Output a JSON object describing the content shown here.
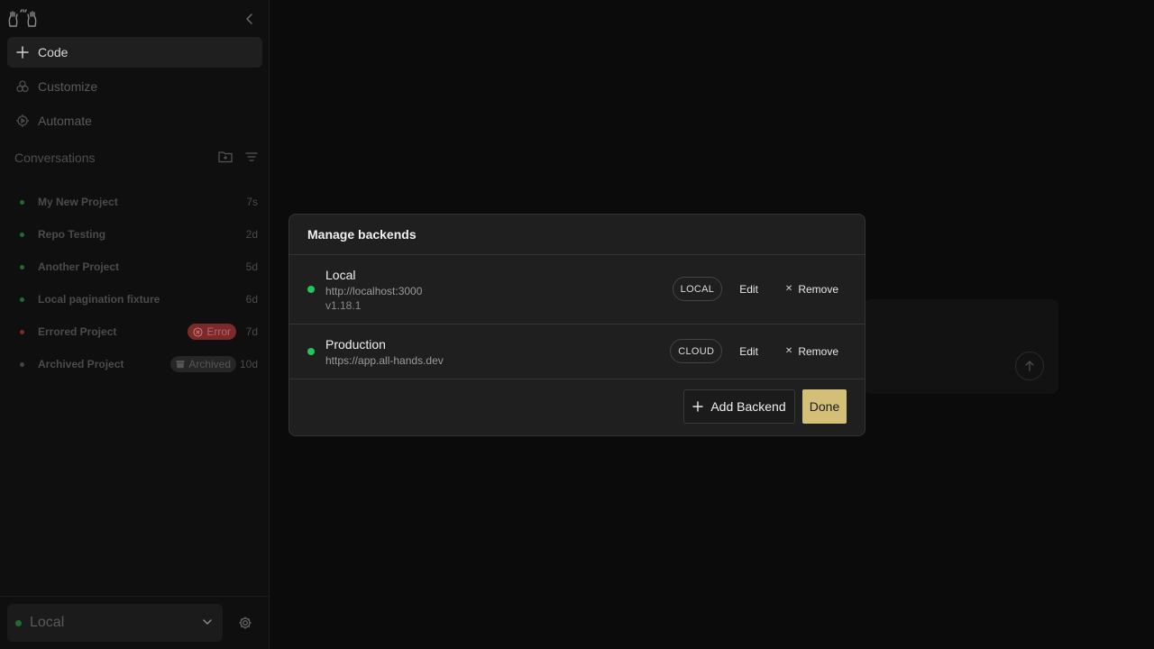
{
  "sidebar": {
    "nav": {
      "code": "Code",
      "customize": "Customize",
      "automate": "Automate"
    },
    "conversations_header": "Conversations",
    "conversations": [
      {
        "name": "My New Project",
        "time": "7s",
        "status_color": "#1f6b32"
      },
      {
        "name": "Repo Testing",
        "time": "2d",
        "status_color": "#1f6b32"
      },
      {
        "name": "Another Project",
        "time": "5d",
        "status_color": "#1f6b32"
      },
      {
        "name": "Local pagination fixture",
        "time": "6d",
        "status_color": "#1f6b32"
      },
      {
        "name": "Errored Project",
        "time": "7d",
        "status_color": "#7a2a2a",
        "badge": "Error"
      },
      {
        "name": "Archived Project",
        "time": "10d",
        "status_color": "#444444",
        "badge": "Archived"
      }
    ],
    "backend_selector": "Local"
  },
  "modal": {
    "title": "Manage backends",
    "backends": [
      {
        "name": "Local",
        "url": "http://localhost:3000",
        "version": "v1.18.1",
        "type": "LOCAL",
        "edit": "Edit",
        "remove": "Remove"
      },
      {
        "name": "Production",
        "url": "https://app.all-hands.dev",
        "type": "CLOUD",
        "edit": "Edit",
        "remove": "Remove"
      }
    ],
    "add_backend": "Add Backend",
    "done": "Done"
  },
  "colors": {
    "accent": "#d4bf79",
    "status_green": "#22c55e",
    "error_badge": "#7a2a2a"
  }
}
